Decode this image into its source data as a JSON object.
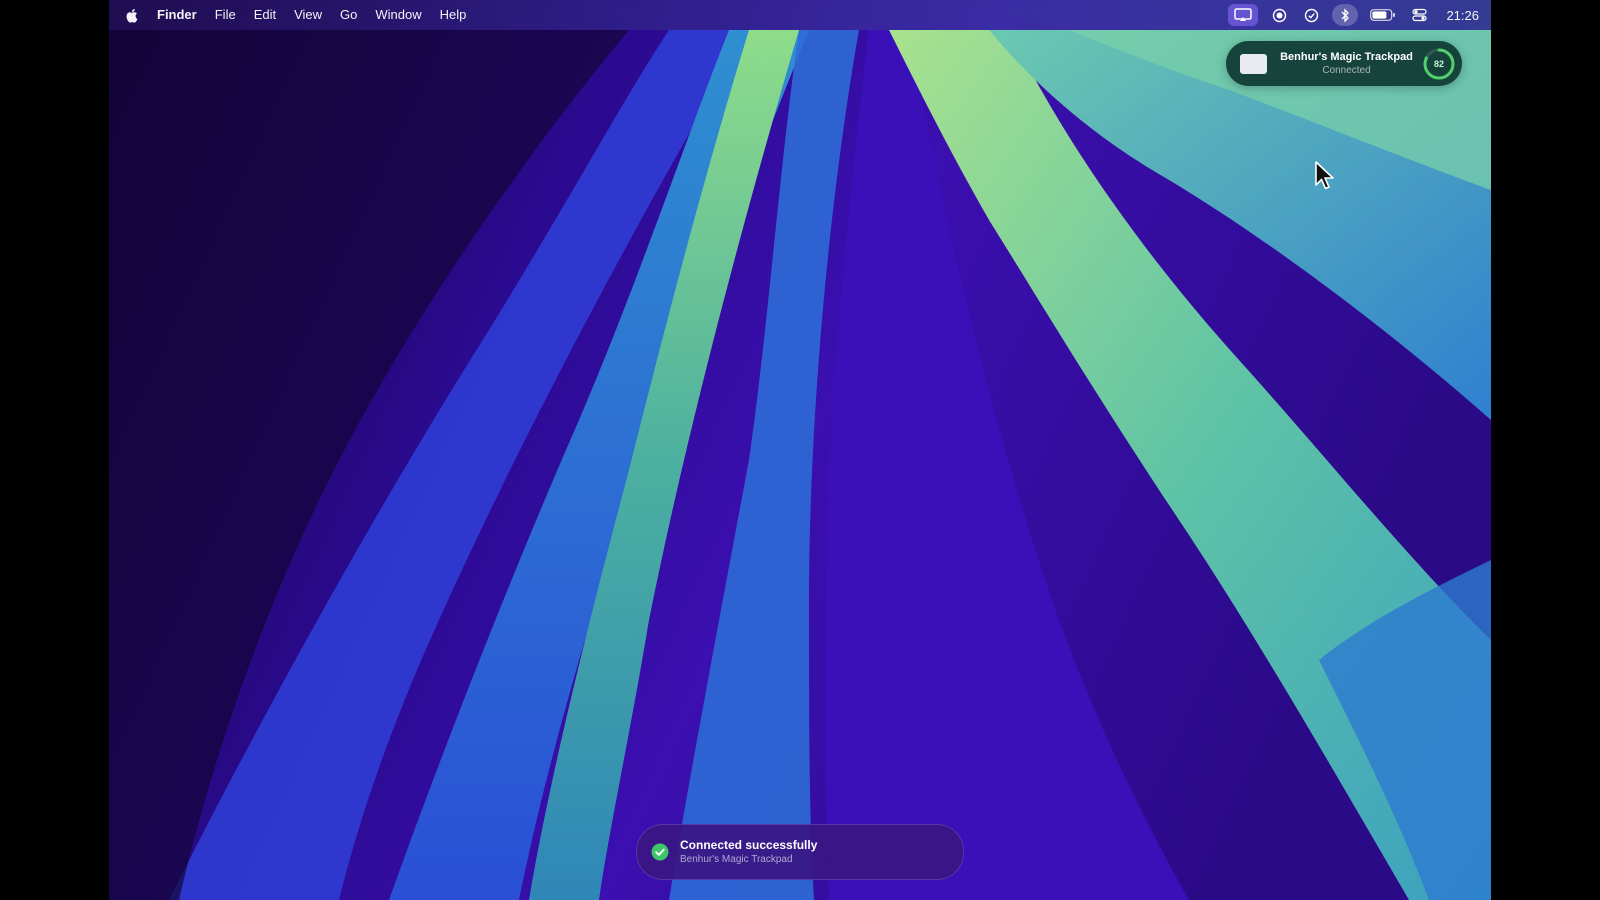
{
  "menubar": {
    "apple_icon": "apple-logo-icon",
    "app_name": "Finder",
    "items": [
      "File",
      "Edit",
      "View",
      "Go",
      "Window",
      "Help"
    ],
    "status_icons": [
      "screen-mirroring-icon",
      "record-icon",
      "check-circle-icon",
      "bluetooth-icon",
      "battery-icon",
      "control-center-icon"
    ],
    "clock": "21:26"
  },
  "hud": {
    "device_icon": "trackpad-icon",
    "title": "Benhur's Magic Trackpad",
    "status": "Connected",
    "battery_percent": "82",
    "battery_level": 0.82,
    "ring_color": "#4fd06a"
  },
  "toast": {
    "icon": "check-circle-icon",
    "title": "Connected successfully",
    "subtitle": "Benhur's Magic Trackpad",
    "check_color": "#3ec46a"
  }
}
